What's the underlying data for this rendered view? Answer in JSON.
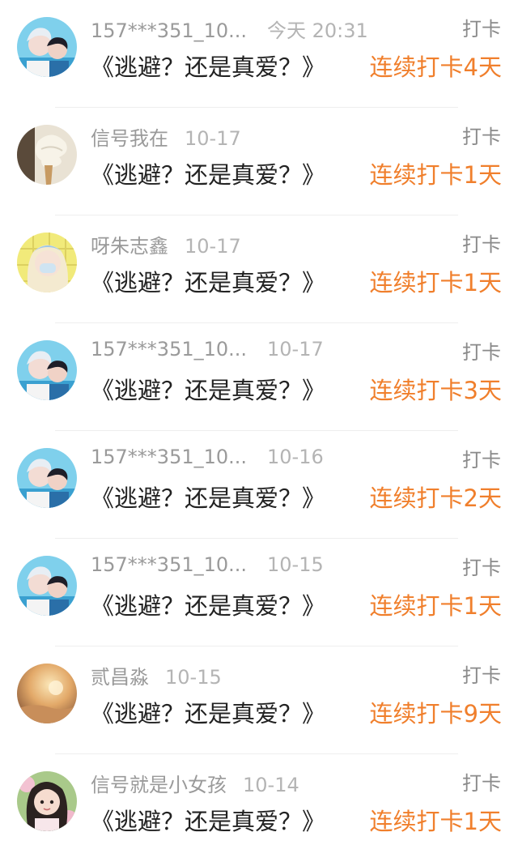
{
  "colors": {
    "accent": "#f07f2c",
    "meta_gray": "#9a9a9a",
    "text": "#222222"
  },
  "records": [
    {
      "user": "157***351_10...",
      "time": "今天 20:31",
      "type": "打卡",
      "title": "《逃避？还是真爱？》",
      "streak": "连续打卡4天",
      "avatar": "couple-photo"
    },
    {
      "user": "信号我在",
      "time": "10-17",
      "type": "打卡",
      "title": "《逃避？还是真爱？》",
      "streak": "连续打卡1天",
      "avatar": "ice-cream-photo"
    },
    {
      "user": "呀朱志鑫",
      "time": "10-17",
      "type": "打卡",
      "title": "《逃避？还是真爱？》",
      "streak": "连续打卡1天",
      "avatar": "masked-girl-photo"
    },
    {
      "user": "157***351_10...",
      "time": "10-17",
      "type": "打卡",
      "title": "《逃避？还是真爱？》",
      "streak": "连续打卡3天",
      "avatar": "couple-photo"
    },
    {
      "user": "157***351_10...",
      "time": "10-16",
      "type": "打卡",
      "title": "《逃避？还是真爱？》",
      "streak": "连续打卡2天",
      "avatar": "couple-photo"
    },
    {
      "user": "157***351_10...",
      "time": "10-15",
      "type": "打卡",
      "title": "《逃避？还是真爱？》",
      "streak": "连续打卡1天",
      "avatar": "couple-photo"
    },
    {
      "user": "贰昌淼",
      "time": "10-15",
      "type": "打卡",
      "title": "《逃避？还是真爱？》",
      "streak": "连续打卡9天",
      "avatar": "sunset-photo"
    },
    {
      "user": "信号就是小女孩",
      "time": "10-14",
      "type": "打卡",
      "title": "《逃避？还是真爱？》",
      "streak": "连续打卡1天",
      "avatar": "little-girl-photo"
    }
  ]
}
